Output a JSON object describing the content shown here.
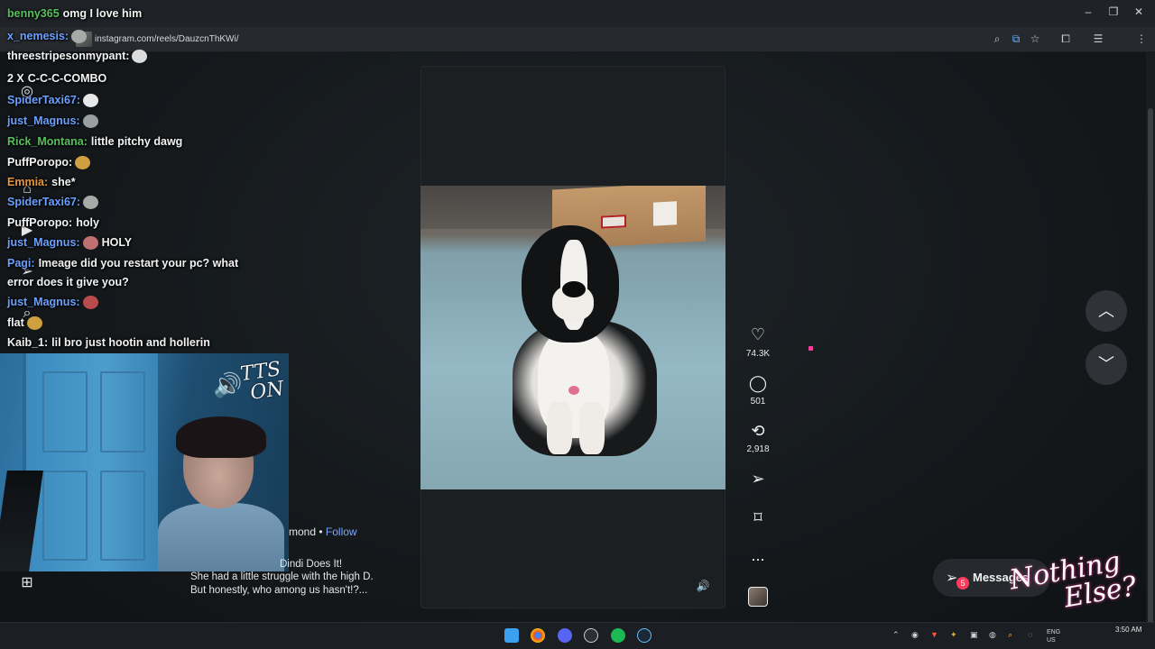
{
  "browser": {
    "url": "instagram.com/reels/DauzcnThKWi/",
    "window_controls": [
      "–",
      "❐",
      "✕"
    ]
  },
  "chat": [
    {
      "user": "benny365",
      "text": "omg I love him",
      "user_color": "#58c05c",
      "has_emote": false
    },
    {
      "user": "x_nemesis:",
      "text": "",
      "user_color": "#6aa0ff",
      "has_emote": true
    },
    {
      "user": "threestripesonmypant:",
      "text": "",
      "user_color": "#f2f2f2",
      "has_emote": true
    },
    {
      "user": "2 X",
      "text": "C-C-C-COMBO",
      "user_color": "#f2f2f2",
      "has_emote": false
    },
    {
      "user": "SpiderTaxi67:",
      "text": "",
      "user_color": "#6aa0ff",
      "has_emote": true
    },
    {
      "user": "just_Magnus:",
      "text": "",
      "user_color": "#6aa0ff",
      "has_emote": true
    },
    {
      "user": "Rick_Montana:",
      "text": "little pitchy dawg",
      "user_color": "#58c05c",
      "has_emote": false
    },
    {
      "user": "PuffPoropo:",
      "text": "",
      "user_color": "#f2f2f2",
      "has_emote": true
    },
    {
      "user": "Emmia:",
      "text": "she*",
      "user_color": "#e6953b",
      "has_emote": false
    },
    {
      "user": "SpiderTaxi67:",
      "text": "",
      "user_color": "#6aa0ff",
      "has_emote": true
    },
    {
      "user": "PuffPoropo:",
      "text": "holy",
      "user_color": "#f2f2f2",
      "has_emote": false
    },
    {
      "user": "just_Magnus:",
      "text": "HOLY",
      "user_color": "#6aa0ff",
      "has_emote": true
    },
    {
      "user": "Pagi:",
      "text": "Imeage did you restart your pc? what",
      "user_color": "#6aa0ff",
      "has_emote": false
    },
    {
      "user": "",
      "text": "error does it give you?",
      "user_color": "#f2f2f2",
      "has_emote": false
    },
    {
      "user": "just_Magnus:",
      "text": "",
      "user_color": "#6aa0ff",
      "has_emote": true
    },
    {
      "user": "flat",
      "text": "",
      "user_color": "#f2f2f2",
      "has_emote": true
    },
    {
      "user": "Kaib_1:",
      "text": "lil bro just hootin and hollerin",
      "user_color": "#f2f2f2",
      "has_emote": false
    }
  ],
  "webcam": {
    "tts_line1": "TTS",
    "tts_line2": "ON"
  },
  "post": {
    "author_fragment": "mond",
    "separator": "•",
    "follow_label": "Follow",
    "caption_line1": "Dindi Does It!",
    "caption_line2": "She had a little struggle with the high D.",
    "caption_line3": "But honestly, who among us hasn't!?..."
  },
  "actions": {
    "likes": "74.3K",
    "comments": "501",
    "reposts": "2,918",
    "more": "..."
  },
  "messages": {
    "label": "Messages",
    "badge": "5"
  },
  "overlay": {
    "line1": "Nothing",
    "line2": "Else?"
  },
  "taskbar": {
    "lang_line1": "ENG",
    "lang_line2": "US",
    "time": "3:50 AM"
  },
  "colors": {
    "accent_blue": "#7da6ff",
    "badge_red": "#ff3b5c",
    "cursor_pink": "#ff3fa0"
  }
}
